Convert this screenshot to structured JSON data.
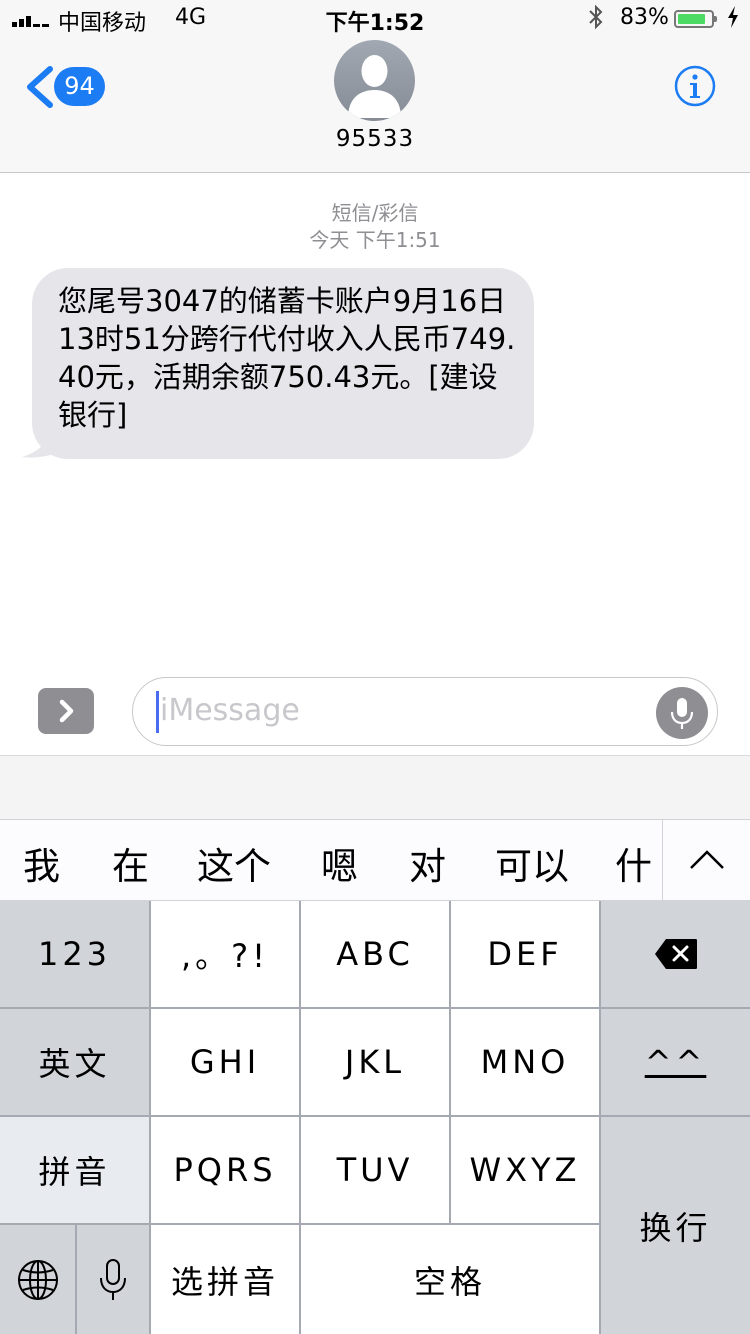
{
  "status_bar": {
    "carrier": "中国移动",
    "network": "4G",
    "time": "下午1:52",
    "battery_percent": "83%",
    "battery_level": 0.83,
    "icons": [
      "signal-icon",
      "bluetooth-icon",
      "battery-icon",
      "charging-icon"
    ]
  },
  "nav": {
    "unread_count": "94",
    "contact_name": "95533",
    "icons": [
      "back-chevron-icon",
      "avatar-placeholder-icon",
      "info-icon"
    ]
  },
  "conversation": {
    "service_label": "短信/彩信",
    "timestamp": "今天 下午1:51",
    "messages": [
      {
        "direction": "incoming",
        "text": "您尾号3047的储蓄卡账户9月16日13时51分跨行代付收入人民币749.40元，活期余额750.43元。[建设银行]"
      }
    ]
  },
  "input_bar": {
    "placeholder": "iMessage",
    "icons": [
      "expand-chevron-icon",
      "microphone-icon"
    ]
  },
  "candidates": [
    "我",
    "在",
    "这个",
    "嗯",
    "对",
    "可以",
    "什"
  ],
  "keyboard": {
    "row1": [
      "123",
      ",。?!",
      "ABC",
      "DEF"
    ],
    "row2": [
      "英文",
      "GHI",
      "JKL",
      "MNO",
      "^^"
    ],
    "row3": [
      "拼音",
      "PQRS",
      "TUV",
      "WXYZ"
    ],
    "row4": [
      "选拼音",
      "空格"
    ],
    "return": "换行",
    "icons": [
      "delete-icon",
      "globe-icon",
      "microphone-icon",
      "collapse-candidates-icon"
    ]
  }
}
